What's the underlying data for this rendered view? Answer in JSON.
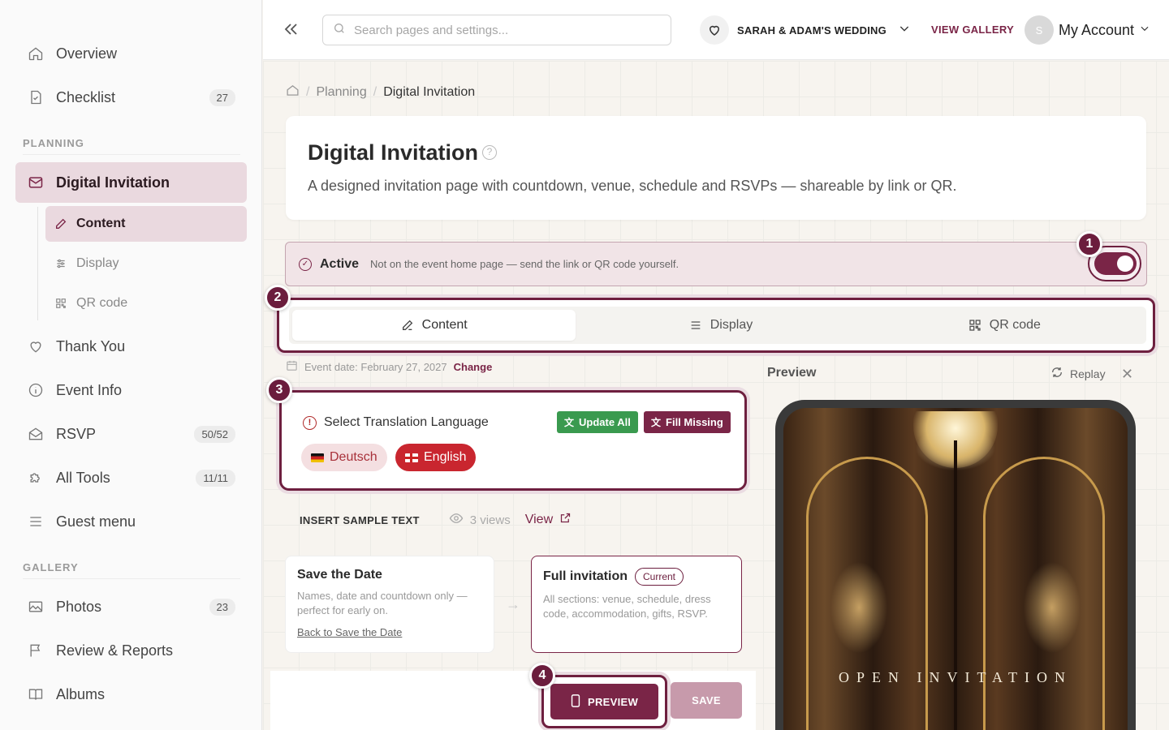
{
  "sidebar": {
    "items": [
      {
        "label": "Overview",
        "badge": ""
      },
      {
        "label": "Checklist",
        "badge": "27"
      },
      {
        "label": "Digital Invitation",
        "badge": ""
      },
      {
        "label": "Thank You",
        "badge": ""
      },
      {
        "label": "Event Info",
        "badge": ""
      },
      {
        "label": "RSVP",
        "badge": "50/52"
      },
      {
        "label": "All Tools",
        "badge": "11/11"
      },
      {
        "label": "Guest menu",
        "badge": ""
      },
      {
        "label": "Photos",
        "badge": "23"
      },
      {
        "label": "Review & Reports",
        "badge": ""
      },
      {
        "label": "Albums",
        "badge": ""
      }
    ],
    "sub_items": [
      {
        "label": "Content"
      },
      {
        "label": "Display"
      },
      {
        "label": "QR code"
      }
    ],
    "sections": {
      "planning": "PLANNING",
      "gallery": "GALLERY"
    }
  },
  "topbar": {
    "search_placeholder": "Search pages and settings...",
    "event_name": "SARAH & ADAM'S WEDDING",
    "view_gallery": "VIEW GALLERY",
    "avatar_initial": "S",
    "account_label": "My Account"
  },
  "breadcrumb": {
    "parent": "Planning",
    "current": "Digital Invitation"
  },
  "header": {
    "title": "Digital Invitation",
    "description": "A designed invitation page with countdown, venue, schedule and RSVPs — shareable by link or QR."
  },
  "status": {
    "label": "Active",
    "note": "Not on the event home page — send the link or QR code yourself.",
    "enabled": true
  },
  "markers": [
    "1",
    "2",
    "3",
    "4"
  ],
  "tabs": [
    {
      "label": "Content"
    },
    {
      "label": "Display"
    },
    {
      "label": "QR code"
    }
  ],
  "event_date": {
    "text": "Event date: February 27, 2027",
    "change": "Change"
  },
  "translation": {
    "title": "Select Translation Language",
    "update_all": "Update All",
    "fill_missing": "Fill Missing",
    "languages": [
      {
        "label": "Deutsch"
      },
      {
        "label": "English"
      }
    ]
  },
  "sample": {
    "insert_label": "INSERT SAMPLE TEXT",
    "views": "3 views",
    "view_link": "View"
  },
  "cards": {
    "save": {
      "title": "Save the Date",
      "desc": "Names, date and countdown only — perfect for early on.",
      "link": "Back to Save the Date"
    },
    "full": {
      "title": "Full invitation",
      "pill": "Current",
      "desc": "All sections: venue, schedule, dress code, accommodation, gifts, RSVP."
    }
  },
  "actions": {
    "preview": "PREVIEW",
    "save": "SAVE"
  },
  "preview_panel": {
    "label": "Preview",
    "replay": "Replay",
    "invite_text": "OPEN INVITATION"
  },
  "colors": {
    "accent": "#7a2547",
    "success": "#3a9a4f",
    "danger": "#c9262f"
  }
}
